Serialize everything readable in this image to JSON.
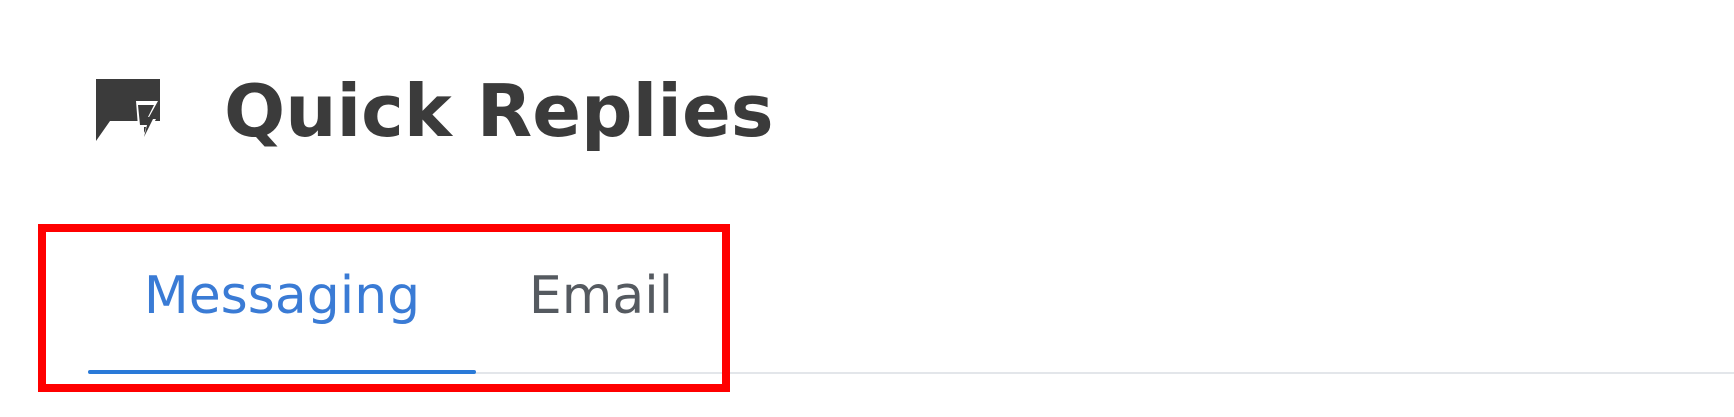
{
  "header": {
    "title": "Quick Replies",
    "icon": "quick-reply-icon",
    "icon_color": "#3b3b3b"
  },
  "tabs": [
    {
      "label": "Messaging",
      "selected": true
    },
    {
      "label": "Email",
      "selected": false
    }
  ],
  "colors": {
    "selected_tab_text": "#3a7bd5",
    "selected_tab_underline": "#2a7ad8",
    "unselected_tab_text": "#555a60",
    "highlight": "#ff0000"
  }
}
